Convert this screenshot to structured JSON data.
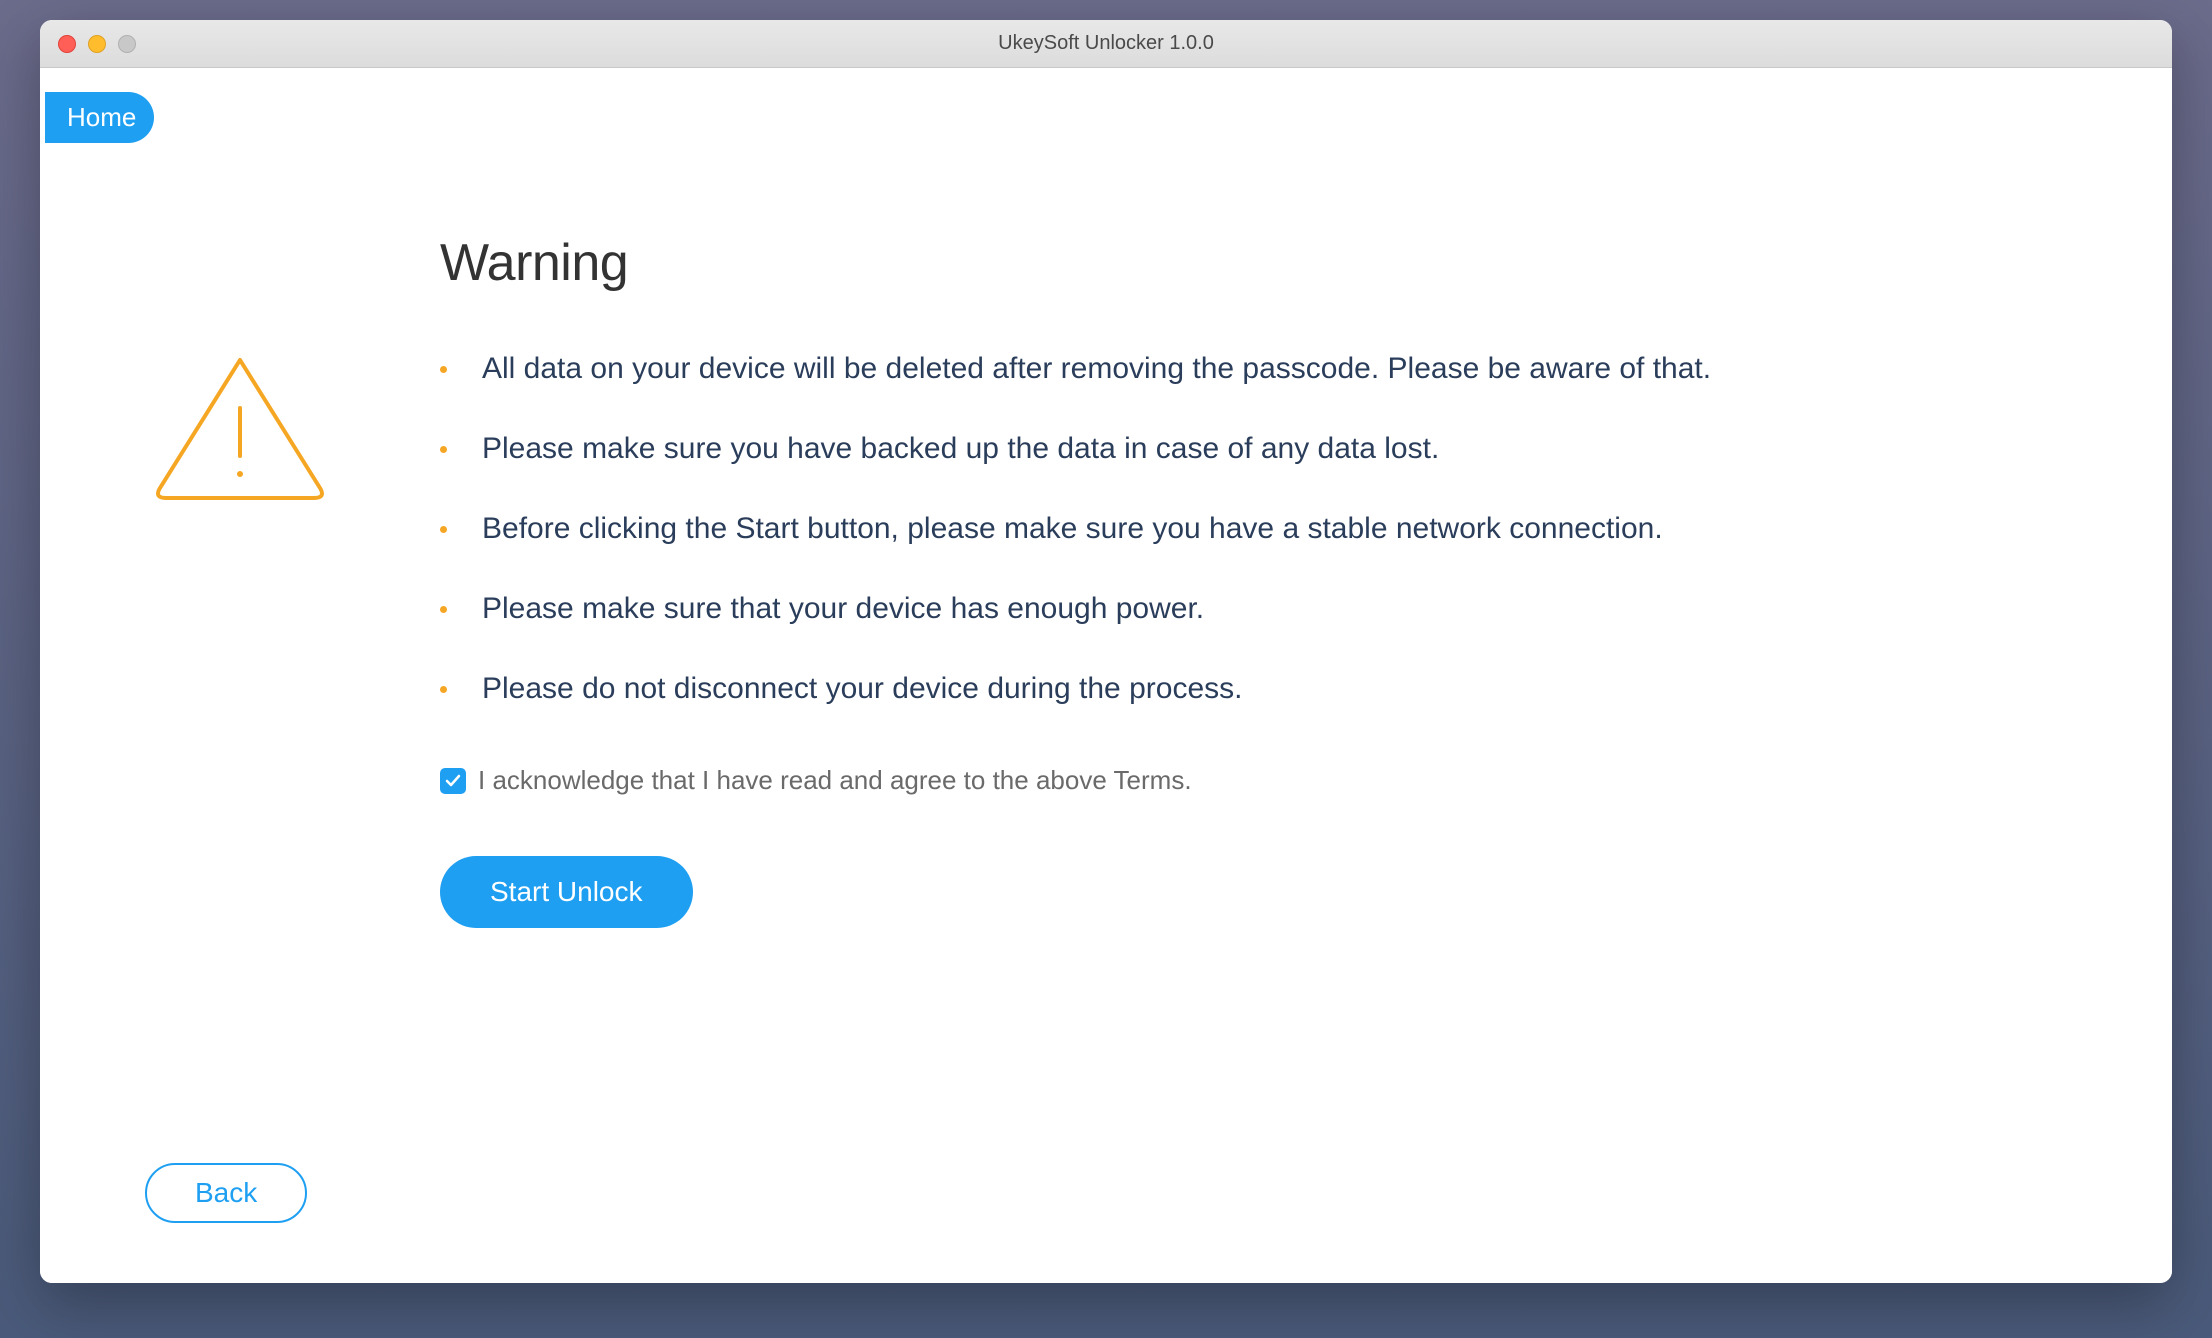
{
  "window": {
    "title": "UkeySoft Unlocker 1.0.0"
  },
  "nav": {
    "home_label": "Home"
  },
  "main": {
    "heading": "Warning",
    "bullets": [
      "All data on your device will be deleted after removing the passcode. Please be aware of that.",
      "Please make sure you have backed up the data in case of any data lost.",
      "Before clicking the Start button, please make sure you have a stable network connection.",
      "Please make sure that your device has enough power.",
      "Please do not disconnect your device during the process."
    ],
    "ack_label": "I acknowledge that I have read and agree to the above Terms.",
    "ack_checked": true,
    "start_label": "Start Unlock",
    "back_label": "Back"
  },
  "colors": {
    "accent": "#1e9ff2",
    "bullet": "#f5a623",
    "text_dark": "#2a3d5a"
  }
}
